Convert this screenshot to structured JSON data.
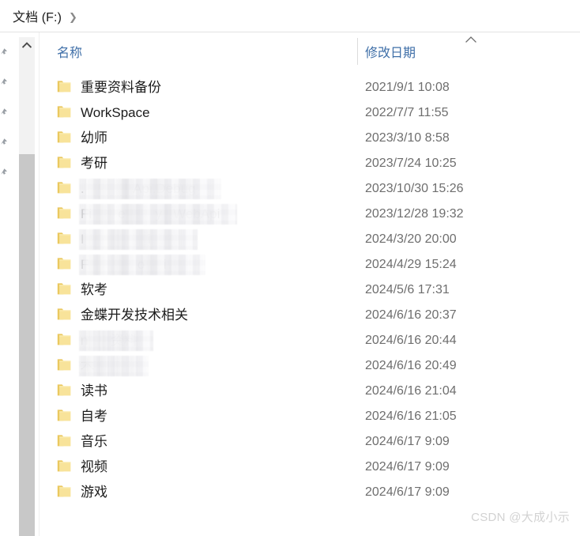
{
  "window": {
    "breadcrumb": {
      "path_label": "文档 (F:)",
      "chevron": "❯"
    }
  },
  "columns": {
    "name_label": "名称",
    "date_label": "修改日期",
    "sort_column": "修改日期",
    "sort_direction": "ascending"
  },
  "colors": {
    "header_text": "#3f6fa8",
    "row_text": "#1c1c1c",
    "date_text": "#6e6e6e",
    "folder_icon": "#f5d97a",
    "scrollbar_thumb": "#c8c8c8",
    "scrollbar_track": "#f2f2f2",
    "watermark": "#d2d2d2"
  },
  "file_list": {
    "item_count": 17,
    "items": [
      {
        "name": "重要资料备份",
        "date": "2021/9/1 10:08",
        "redacted": false,
        "redact_width": 0
      },
      {
        "name": "WorkSpace",
        "date": "2022/7/7 11:55",
        "redacted": false,
        "redact_width": 0
      },
      {
        "name": "幼师",
        "date": "2023/3/10 8:58",
        "redacted": false,
        "redact_width": 0
      },
      {
        "name": "考研",
        "date": "2023/7/24 10:25",
        "redacted": false,
        "redact_width": 0
      },
      {
        "name": ".             Api.Debug",
        "date": "2023/10/30 15:26",
        "redacted": true,
        "redact_width": 180
      },
      {
        "name": "Fi       e        y   WebApi",
        "date": "2023/12/28 19:32",
        "redacted": true,
        "redact_width": 200
      },
      {
        "name": "I                 i",
        "date": "2024/3/20 20:00",
        "redacted": true,
        "redact_width": 150
      },
      {
        "name": "F             o     i",
        "date": "2024/4/29 15:24",
        "redacted": true,
        "redact_width": 160
      },
      {
        "name": "软考",
        "date": "2024/5/6 17:31",
        "redacted": false,
        "redact_width": 0
      },
      {
        "name": "金蝶开发技术相关",
        "date": "2024/6/16 20:37",
        "redacted": false,
        "redact_width": 0
      },
      {
        "name": "n      资料",
        "date": "2024/6/16 20:44",
        "redacted": true,
        "redact_width": 94
      },
      {
        "name": "木        ",
        "date": "2024/6/16 20:49",
        "redacted": true,
        "redact_width": 88
      },
      {
        "name": "读书",
        "date": "2024/6/16 21:04",
        "redacted": false,
        "redact_width": 0
      },
      {
        "name": "自考",
        "date": "2024/6/16 21:05",
        "redacted": false,
        "redact_width": 0
      },
      {
        "name": "音乐",
        "date": "2024/6/17 9:09",
        "redacted": false,
        "redact_width": 0
      },
      {
        "name": "视频",
        "date": "2024/6/17 9:09",
        "redacted": false,
        "redact_width": 0
      },
      {
        "name": "游戏",
        "date": "2024/6/17 9:09",
        "redacted": false,
        "redact_width": 0
      }
    ]
  },
  "nav_rail": {
    "pin_count": 5,
    "icon": "pin-arrow-icon"
  },
  "scrollbar": {
    "up_arrow": "chevron-up-icon",
    "orientation": "vertical"
  },
  "watermark": {
    "text": "CSDN @大成小示"
  }
}
